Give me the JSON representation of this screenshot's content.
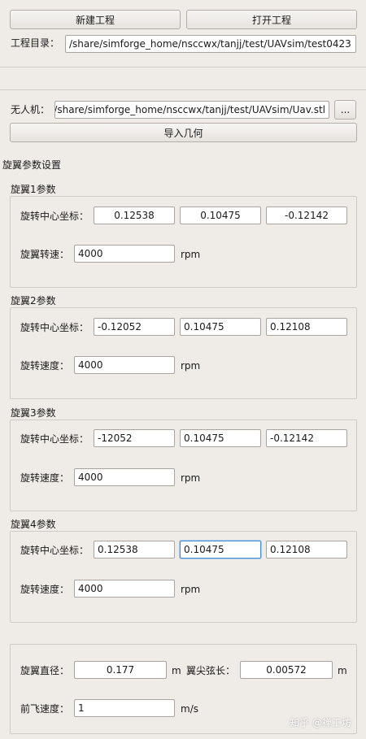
{
  "project": {
    "new_label": "新建工程",
    "open_label": "打开工程",
    "dir_label": "工程目录：",
    "dir_value": "/share/simforge_home/nsccwx/tanjj/test/UAVsim/test0423"
  },
  "uav": {
    "label": "无人机：",
    "path_value": "/share/simforge_home/nsccwx/tanjj/test/UAVsim/Uav.stl",
    "browse_label": "...",
    "import_label": "导入几何"
  },
  "rotor_settings": {
    "title": "旋翼参数设置",
    "rotors": [
      {
        "title": "旋翼1参数",
        "center_label": "旋转中心坐标：",
        "x": "0.12538",
        "y": "0.10475",
        "z": "-0.12142",
        "speed_label": "旋翼转速：",
        "speed": "4000",
        "unit": "rpm"
      },
      {
        "title": "旋翼2参数",
        "center_label": "旋转中心坐标：",
        "x": "-0.12052",
        "y": "0.10475",
        "z": "0.12108",
        "speed_label": "旋转速度：",
        "speed": "4000",
        "unit": "rpm"
      },
      {
        "title": "旋翼3参数",
        "center_label": "旋转中心坐标：",
        "x": "-12052",
        "y": "0.10475",
        "z": "-0.12142",
        "speed_label": "旋转速度：",
        "speed": "4000",
        "unit": "rpm"
      },
      {
        "title": "旋翼4参数",
        "center_label": "旋转中心坐标：",
        "x": "0.12538",
        "y": "0.10475",
        "z": "0.12108",
        "speed_label": "旋转速度：",
        "speed": "4000",
        "unit": "rpm"
      }
    ]
  },
  "general": {
    "diameter_label": "旋翼直径：",
    "diameter_value": "0.177",
    "diameter_unit": "m",
    "tip_chord_label": "翼尖弦长：",
    "tip_chord_value": "0.00572",
    "tip_chord_unit": "m",
    "forward_speed_label": "前飞速度：",
    "forward_speed_value": "1",
    "forward_speed_unit": "m/s"
  },
  "watermark": "知乎 @禅工坊"
}
